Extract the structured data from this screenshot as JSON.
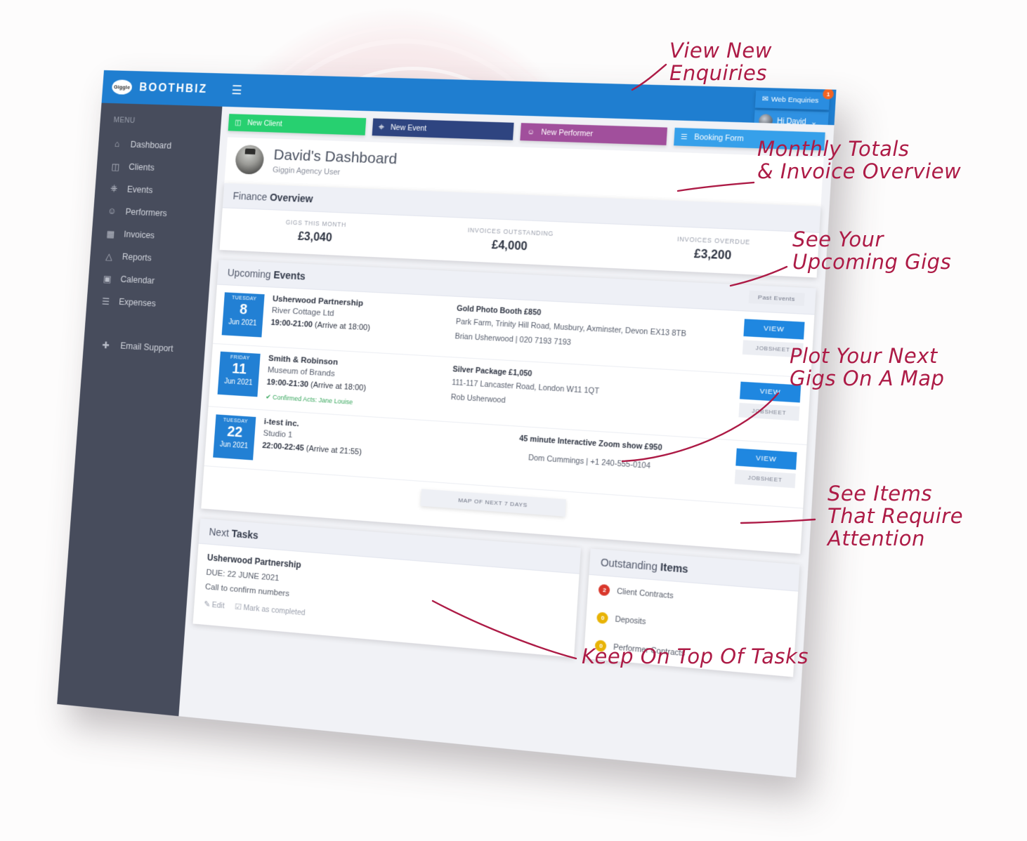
{
  "brand": {
    "logo_text": "Giggle",
    "name": "BOOTHBIZ",
    "menu_icon": "hamburger-icon"
  },
  "topbar": {
    "enquiries_label": "Web Enquiries",
    "enquiries_badge": "1",
    "user_label": "Hi David",
    "chevron": "⌄"
  },
  "sidebar": {
    "heading": "MENU",
    "items": [
      {
        "label": "Dashboard",
        "icon": "home-icon"
      },
      {
        "label": "Clients",
        "icon": "contact-card-icon"
      },
      {
        "label": "Events",
        "icon": "microphone-icon"
      },
      {
        "label": "Performers",
        "icon": "person-icon"
      },
      {
        "label": "Invoices",
        "icon": "invoice-icon"
      },
      {
        "label": "Reports",
        "icon": "chart-line-icon"
      },
      {
        "label": "Calendar",
        "icon": "calendar-icon"
      },
      {
        "label": "Expenses",
        "icon": "receipt-icon"
      }
    ],
    "support": {
      "label": "Email Support",
      "icon": "lifebuoy-icon"
    }
  },
  "actions": [
    {
      "label": "New Client",
      "icon": "contact-card-icon",
      "color": "#27d070"
    },
    {
      "label": "New Event",
      "icon": "microphone-icon",
      "color": "#2e4480"
    },
    {
      "label": "New Performer",
      "icon": "person-icon",
      "color": "#a14f9c"
    },
    {
      "label": "Booking Form",
      "icon": "form-lines-icon",
      "color": "#36a0ea"
    }
  ],
  "dashboard_header": {
    "title": "David's Dashboard",
    "subtitle": "Giggin Agency User",
    "avatar": "user-avatar"
  },
  "finance": {
    "title_prefix": "Finance ",
    "title_bold": "Overview",
    "cells": [
      {
        "label": "GIGS THIS MONTH",
        "value": "£3,040"
      },
      {
        "label": "INVOICES OUTSTANDING",
        "value": "£4,000"
      },
      {
        "label": "INVOICES OVERDUE",
        "value": "£3,200"
      }
    ]
  },
  "events": {
    "title_prefix": "Upcoming ",
    "title_bold": "Events",
    "past_button": "Past Events",
    "view_label": "VIEW",
    "jobsheet_label": "JOBSHEET",
    "map_button": "MAP OF NEXT 7 DAYS",
    "list": [
      {
        "dow": "TUESDAY",
        "day": "8",
        "month": "Jun 2021",
        "client": "Usherwood Partnership",
        "venue": "River Cottage Ltd",
        "time_bold": "19:00-21:00",
        "time_rest": " (Arrive at 18:00)",
        "package": "Gold Photo Booth £850",
        "address": "Park Farm, Trinity Hill Road, Musbury, Axminster, Devon EX13 8TB",
        "contact": "Brian Usherwood | 020 7193 7193",
        "acts": ""
      },
      {
        "dow": "FRIDAY",
        "day": "11",
        "month": "Jun 2021",
        "client": "Smith & Robinson",
        "venue": "Museum of Brands",
        "time_bold": "19:00-21:30",
        "time_rest": " (Arrive at 18:00)",
        "package": "Silver Package £1,050",
        "address": "111-117 Lancaster Road, London W11 1QT",
        "contact": "Rob Usherwood",
        "acts": "✔ Confirmed Acts: Jane Louise"
      },
      {
        "dow": "TUESDAY",
        "day": "22",
        "month": "Jun 2021",
        "client": "i-test inc.",
        "venue": "Studio 1",
        "time_bold": "22:00-22:45",
        "time_rest": " (Arrive at 21:55)",
        "package": "45 minute Interactive Zoom show £950",
        "address": "",
        "contact": "Dom Cummings | +1 240-555-0104",
        "acts": ""
      }
    ]
  },
  "tasks": {
    "title_prefix": "Next ",
    "title_bold": "Tasks",
    "item": {
      "title": "Usherwood Partnership",
      "due": "DUE: 22 JUNE 2021",
      "note": "Call to confirm numbers",
      "edit_label": "Edit",
      "complete_label": "Mark as completed",
      "edit_icon": "pencil-icon",
      "complete_icon": "checkbox-icon"
    }
  },
  "outstanding": {
    "title_prefix": "Outstanding ",
    "title_bold": "Items",
    "items": [
      {
        "count": "2",
        "label": "Client Contracts",
        "color": "#d9372b"
      },
      {
        "count": "0",
        "label": "Deposits",
        "color": "#e8b306"
      },
      {
        "count": "0",
        "label": "Performer Contracts",
        "color": "#e8b306"
      }
    ]
  },
  "annotations": [
    {
      "id": "a1",
      "text": "View New\nEnquiries"
    },
    {
      "id": "a2",
      "text": "Monthly Totals\n& Invoice Overview"
    },
    {
      "id": "a3",
      "text": "See Your\nUpcoming Gigs"
    },
    {
      "id": "a4",
      "text": "Plot Your Next\nGigs On A Map"
    },
    {
      "id": "a5",
      "text": "See Items\nThat Require\nAttention"
    },
    {
      "id": "a6",
      "text": "Keep On Top Of Tasks"
    }
  ],
  "colors": {
    "topbar": "#1f7ed0",
    "sidebar": "#474c5c",
    "accent_blue": "#2280d4",
    "annotation": "#ad1b46",
    "blush": "#f3dfe2"
  }
}
